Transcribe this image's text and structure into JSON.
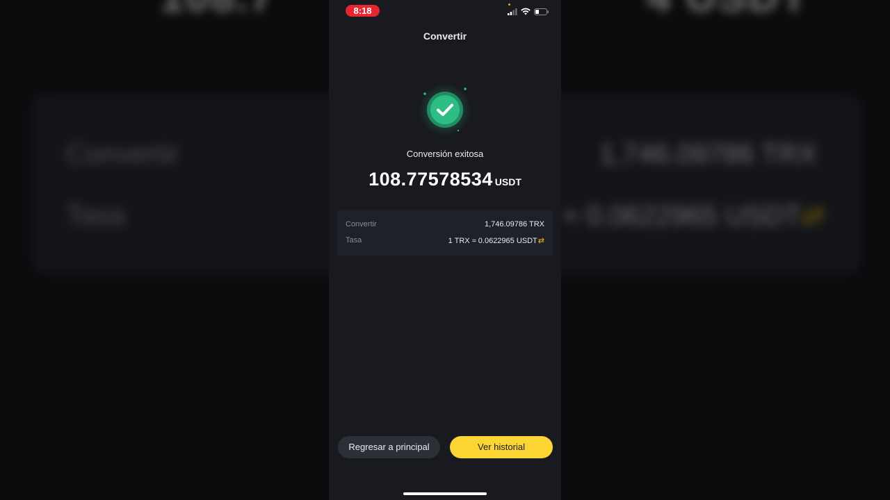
{
  "background": {
    "amount_left": "108.7",
    "amount_right": "4 USDT",
    "label_convert": "Convertir",
    "label_rate": "Tasa",
    "value_convert": "1,746.09786 TRX",
    "value_rate": "≈ 0.0622965 USDT",
    "swap_glyph": "⇄"
  },
  "status_bar": {
    "time": "8:18",
    "icons": [
      "signal-icon",
      "wifi-icon",
      "battery-icon"
    ]
  },
  "header": {
    "title": "Convertir"
  },
  "result": {
    "icon": "success-check-icon",
    "status": "Conversión exitosa",
    "amount": "108.77578534",
    "unit": "USDT"
  },
  "details": {
    "rows": [
      {
        "label": "Convertir",
        "value": "1,746.09786 TRX"
      },
      {
        "label": "Tasa",
        "value": "1 TRX ≈ 0.0622965 USDT"
      }
    ],
    "swap_icon": "⇄"
  },
  "actions": {
    "home_label": "Regresar a principal",
    "history_label": "Ver historial"
  },
  "colors": {
    "accent": "#fcd535",
    "success": "#2ebd85",
    "time_pill": "#e8262f",
    "app_bg": "#181a20"
  }
}
